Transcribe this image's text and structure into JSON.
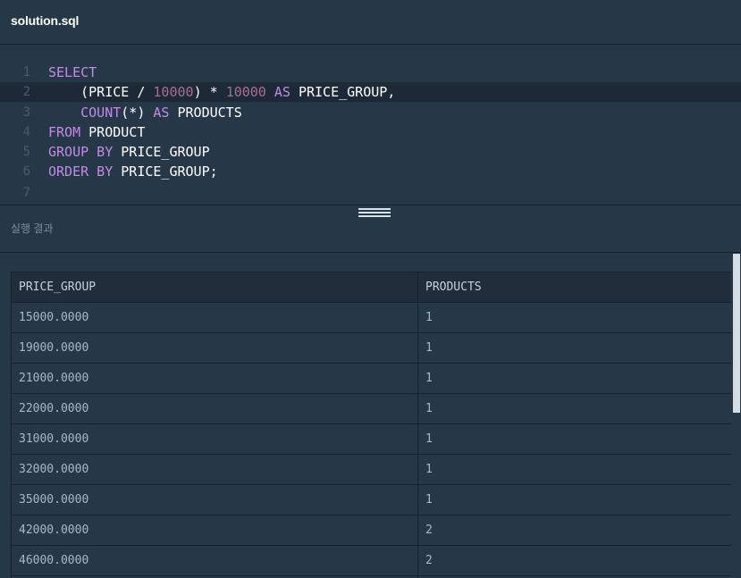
{
  "file": {
    "name": "solution.sql"
  },
  "editor": {
    "lines": [
      {
        "no": "1",
        "tokens": [
          {
            "t": "SELECT",
            "c": "kw"
          }
        ]
      },
      {
        "no": "2",
        "tokens": [
          {
            "t": "    (PRICE / ",
            "c": "plain"
          },
          {
            "t": "10000",
            "c": "num"
          },
          {
            "t": ") * ",
            "c": "plain"
          },
          {
            "t": "10000",
            "c": "num"
          },
          {
            "t": " AS ",
            "c": "kw"
          },
          {
            "t": "PRICE_GROUP,",
            "c": "plain"
          }
        ]
      },
      {
        "no": "3",
        "tokens": [
          {
            "t": "    COUNT",
            "c": "kw"
          },
          {
            "t": "(*) ",
            "c": "plain"
          },
          {
            "t": "AS",
            "c": "kw"
          },
          {
            "t": " PRODUCTS",
            "c": "plain"
          }
        ]
      },
      {
        "no": "4",
        "tokens": [
          {
            "t": "FROM",
            "c": "kw"
          },
          {
            "t": " PRODUCT",
            "c": "plain"
          }
        ]
      },
      {
        "no": "5",
        "tokens": [
          {
            "t": "GROUP BY",
            "c": "kw"
          },
          {
            "t": " PRICE_GROUP",
            "c": "plain"
          }
        ]
      },
      {
        "no": "6",
        "tokens": [
          {
            "t": "ORDER BY",
            "c": "kw"
          },
          {
            "t": " PRICE_GROUP;",
            "c": "plain"
          }
        ]
      },
      {
        "no": "7",
        "tokens": []
      }
    ],
    "active_line": "2"
  },
  "results": {
    "title": "실행 결과",
    "columns": [
      "PRICE_GROUP",
      "PRODUCTS"
    ],
    "rows": [
      [
        "15000.0000",
        "1"
      ],
      [
        "19000.0000",
        "1"
      ],
      [
        "21000.0000",
        "1"
      ],
      [
        "22000.0000",
        "1"
      ],
      [
        "31000.0000",
        "1"
      ],
      [
        "32000.0000",
        "1"
      ],
      [
        "35000.0000",
        "1"
      ],
      [
        "42000.0000",
        "2"
      ],
      [
        "46000.0000",
        "2"
      ],
      [
        "",
        ""
      ]
    ]
  },
  "colors": {
    "background": "#263747",
    "keyword": "#c38ae8",
    "number": "#a7708f",
    "active_line": "#1d2936"
  }
}
